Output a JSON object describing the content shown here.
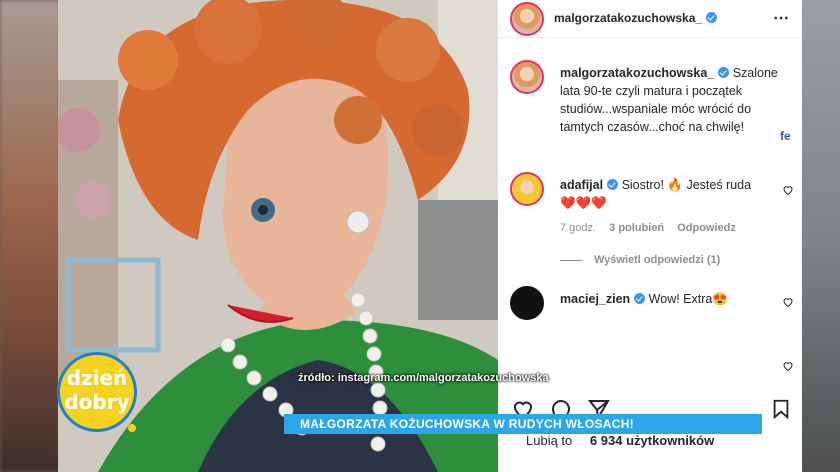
{
  "post": {
    "author": "malgorzatakozuchowska_",
    "more_icon": "⋯",
    "caption_author": "malgorzatakozuchowska_",
    "caption": "Szalone lata 90-te czyli matura i początek studiów...wspaniale móc wrócić do tamtych czasów...choć na chwilę!",
    "caption_tail": "fe"
  },
  "comments": [
    {
      "author": "adafijal",
      "text": "Siostro! 🔥 Jesteś ruda",
      "hearts": "❤️❤️❤️",
      "time": "7 godz.",
      "likes": "3 polubień",
      "reply": "Odpowiedz",
      "view_replies": "Wyświetl odpowiedzi (1)"
    },
    {
      "author": "maciej_zien",
      "text": "Wow! Extra😍"
    }
  ],
  "likes": {
    "prefix": "Lubią to",
    "count": "6 934",
    "suffix": "użytkowników"
  },
  "overlay": {
    "logo_line1": "dzień",
    "logo_line2": "dobry",
    "source": "źródło: instagram.com/malgorzatakozuchowska",
    "headline": "MAŁGORZATA KOŻUCHOWSKA W RUDYCH WŁOSACH!"
  },
  "colors": {
    "banner": "#2ba6e8",
    "logo": "#f4d21f",
    "verified": "#3897f0"
  }
}
